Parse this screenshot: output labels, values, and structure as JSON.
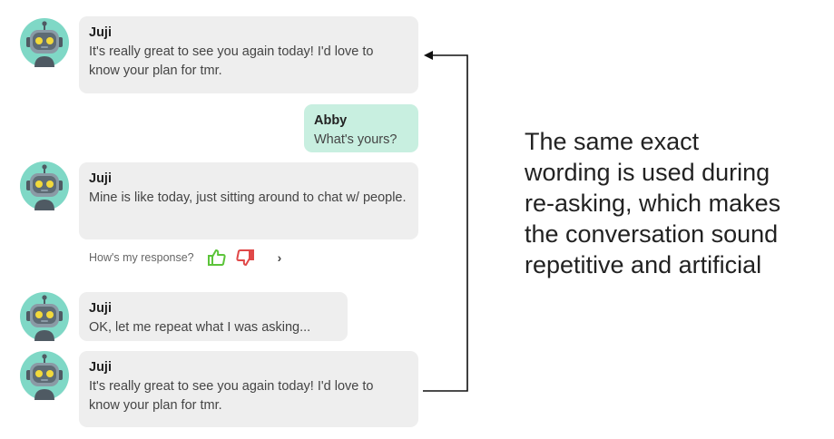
{
  "messages": [
    {
      "sender": "Juji",
      "text": "It's really great to see you again today! I'd love to know your plan for tmr."
    },
    {
      "sender": "Abby",
      "text": "What's yours?"
    },
    {
      "sender": "Juji",
      "text": "Mine is like today, just sitting around to chat w/ people."
    },
    {
      "sender": "Juji",
      "text": "OK, let me repeat what I was asking..."
    },
    {
      "sender": "Juji",
      "text": "It's really great to see you again today! I'd love to know your plan for tmr."
    }
  ],
  "feedback": {
    "label": "How's my response?",
    "thumbs_up_icon": "thumbs-up-icon",
    "thumbs_down_icon": "thumbs-down-icon",
    "more_icon": "chevron-right-icon"
  },
  "annotation": {
    "text": "The same exact\nwording is used during\nre-asking, which makes\nthe conversation sound\nrepetitive and artificial"
  },
  "colors": {
    "bot_bubble": "#eeeeee",
    "user_bubble": "#c8efe0",
    "avatar_bg": "#7fd8c6",
    "thumbs_up": "#5cc43a",
    "thumbs_down": "#e04848"
  }
}
